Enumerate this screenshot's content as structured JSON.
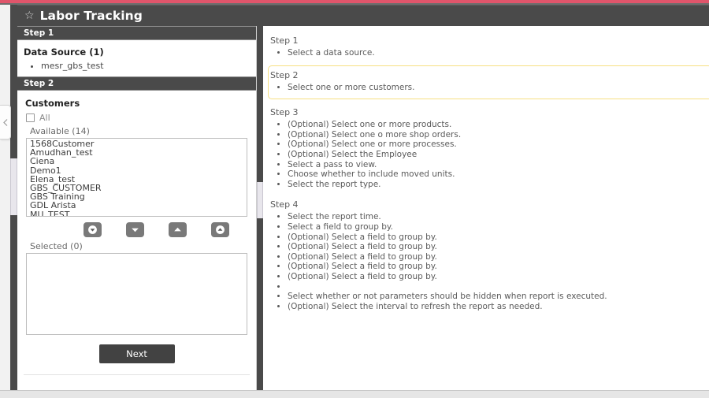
{
  "theme": {
    "accent_line": "#e0556b",
    "header_bg": "#4a4a4a",
    "highlight_border": "#f6df82",
    "button_bg": "#424242",
    "xfer_button_bg": "#797979"
  },
  "window": {
    "title": "Labor Tracking",
    "star_icon": "star-icon",
    "collapse_icon": "chevron-left-icon"
  },
  "wizard": {
    "step1": {
      "header": "Step 1",
      "data_source_label": "Data Source (1)",
      "data_sources": [
        "mesr_gbs_test"
      ]
    },
    "step2": {
      "header": "Step 2",
      "section_title": "Customers",
      "all_label": "All",
      "all_checked": false,
      "available_label": "Available (14)",
      "available_items": [
        "1568Customer",
        "Amudhan_test",
        "Ciena",
        "Demo1",
        "Elena_test",
        "GBS_CUSTOMER",
        "GBS Training",
        "GDL Arista",
        "MU_TEST"
      ],
      "selected_label": "Selected (0)",
      "selected_items": [],
      "transfer_buttons": [
        {
          "name": "move-all-down-button",
          "icon": "circle-down-triangle-icon"
        },
        {
          "name": "move-down-button",
          "icon": "down-triangle-icon"
        },
        {
          "name": "move-up-button",
          "icon": "up-triangle-icon"
        },
        {
          "name": "move-all-up-button",
          "icon": "circle-up-triangle-icon"
        }
      ],
      "next_label": "Next"
    }
  },
  "instructions": [
    {
      "step": "Step 1",
      "highlighted": false,
      "items": [
        "Select a data source."
      ]
    },
    {
      "step": "Step 2",
      "highlighted": true,
      "items": [
        "Select one or more customers."
      ]
    },
    {
      "step": "Step 3",
      "highlighted": false,
      "items": [
        "(Optional) Select one or more products.",
        "(Optional) Select one o more shop orders.",
        "(Optional) Select one or more processes.",
        "(Optional) Select the Employee",
        "Select a pass to view.",
        "Choose whether to include moved units.",
        "Select the report type."
      ]
    },
    {
      "step": "Step 4",
      "highlighted": false,
      "items": [
        "Select the report time.",
        "Select a field to group by.",
        "(Optional) Select a field to group by.",
        "(Optional) Select a field to group by.",
        "(Optional) Select a field to group by.",
        "(Optional) Select a field to group by.",
        "(Optional) Select a field to group by.",
        "",
        "Select whether or not parameters should be hidden when report is executed.",
        "(Optional) Select the interval to refresh the report as needed."
      ]
    }
  ]
}
